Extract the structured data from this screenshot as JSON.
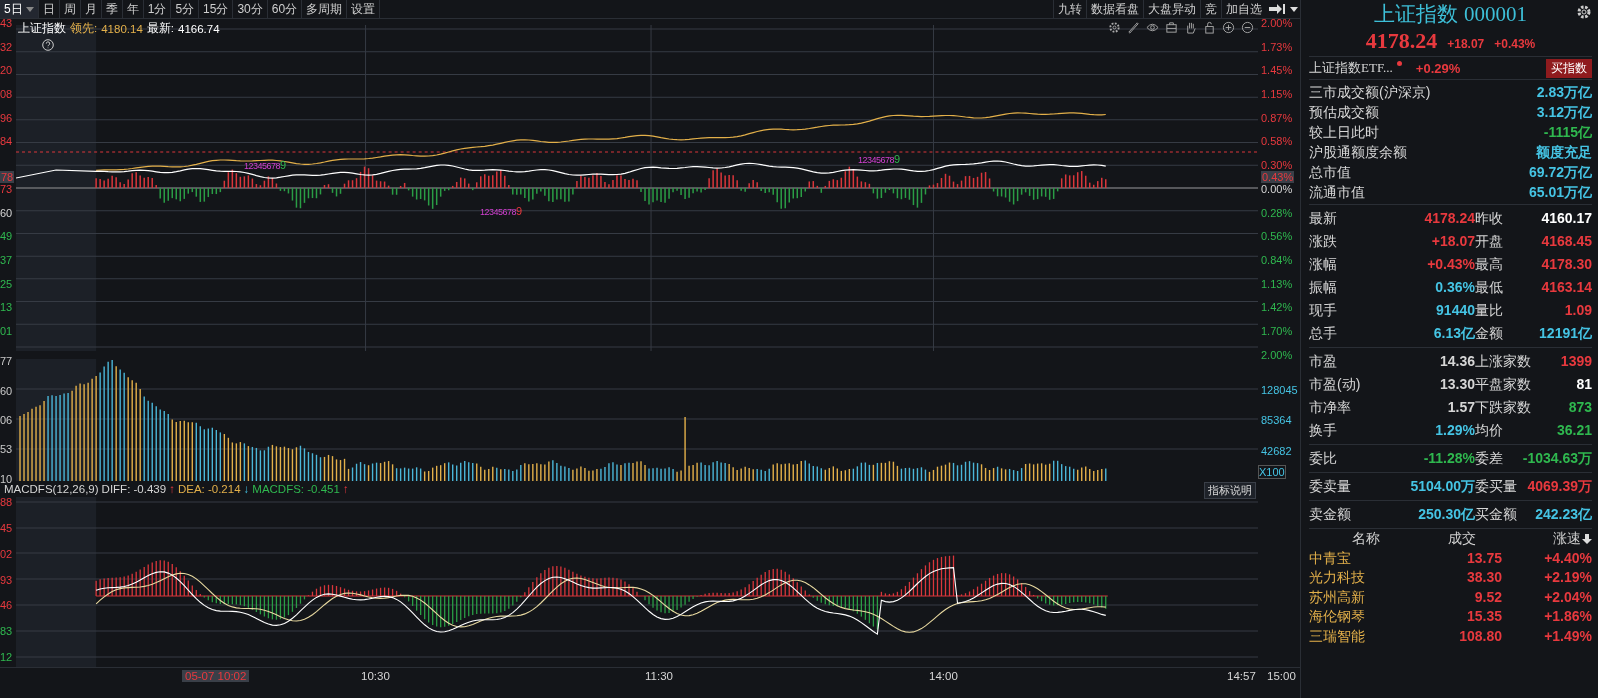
{
  "toolbar": {
    "periods": [
      {
        "label": "5日",
        "selected": true,
        "dropdown": true
      },
      {
        "label": "日",
        "selected": false,
        "dropdown": false
      },
      {
        "label": "周",
        "selected": false,
        "dropdown": false
      },
      {
        "label": "月",
        "selected": false,
        "dropdown": false
      },
      {
        "label": "季",
        "selected": false,
        "dropdown": false
      },
      {
        "label": "年",
        "selected": false,
        "dropdown": false
      },
      {
        "label": "1分",
        "selected": false,
        "dropdown": false
      },
      {
        "label": "5分",
        "selected": false,
        "dropdown": false
      },
      {
        "label": "15分",
        "selected": false,
        "dropdown": false
      },
      {
        "label": "30分",
        "selected": false,
        "dropdown": false
      },
      {
        "label": "60分",
        "selected": false,
        "dropdown": false
      },
      {
        "label": "多周期",
        "selected": false,
        "dropdown": false
      },
      {
        "label": "设置",
        "selected": false,
        "dropdown": false
      }
    ],
    "tools": [
      "九转",
      "数据看盘",
      "大盘异动",
      "竞",
      "加自选"
    ]
  },
  "chart_header": {
    "name": "上证指数",
    "lead_label": "领先:",
    "lead_value": "4180.14",
    "latest_label": "最新:",
    "latest_value": "4166.74"
  },
  "price_pane": {
    "left_ticks": [
      {
        "label": "43",
        "kind": "up"
      },
      {
        "label": "32",
        "kind": "up"
      },
      {
        "label": "20",
        "kind": "up"
      },
      {
        "label": "08",
        "kind": "up"
      },
      {
        "label": "96",
        "kind": "up"
      },
      {
        "label": "84",
        "kind": "up"
      },
      {
        "label": "73",
        "kind": "up"
      },
      {
        "label": "60",
        "kind": "flat"
      },
      {
        "label": "49",
        "kind": "down"
      },
      {
        "label": "37",
        "kind": "down"
      },
      {
        "label": "25",
        "kind": "down"
      },
      {
        "label": "13",
        "kind": "down"
      },
      {
        "label": "01",
        "kind": "down"
      }
    ],
    "left_current": "78",
    "right_ticks": [
      {
        "label": "2.00%",
        "kind": "up"
      },
      {
        "label": "1.73%",
        "kind": "up"
      },
      {
        "label": "1.45%",
        "kind": "up"
      },
      {
        "label": "1.15%",
        "kind": "up"
      },
      {
        "label": "0.87%",
        "kind": "up"
      },
      {
        "label": "0.58%",
        "kind": "up"
      },
      {
        "label": "0.30%",
        "kind": "up"
      },
      {
        "label": "0.00%",
        "kind": "flat"
      },
      {
        "label": "0.28%",
        "kind": "down"
      },
      {
        "label": "0.56%",
        "kind": "down"
      },
      {
        "label": "0.84%",
        "kind": "down"
      },
      {
        "label": "1.13%",
        "kind": "down"
      },
      {
        "label": "1.42%",
        "kind": "down"
      },
      {
        "label": "1.70%",
        "kind": "down"
      },
      {
        "label": "2.00%",
        "kind": "down"
      }
    ],
    "right_current": "0.43%",
    "markers": [
      {
        "digits": "12345678",
        "last": "9",
        "kind": "down"
      },
      {
        "digits": "12345678",
        "last": "9",
        "kind": "up"
      },
      {
        "digits": "12345678",
        "last": "9",
        "kind": "down"
      }
    ]
  },
  "volume_pane": {
    "left_ticks": [
      "77",
      "60",
      "06",
      "53",
      "10"
    ],
    "right_ticks": [
      "128045",
      "85364",
      "42682"
    ],
    "unit": "X100"
  },
  "macd_pane": {
    "legend": [
      {
        "text": "MACDFS(12,26,9)",
        "kind": "flat"
      },
      {
        "text": "DIFF: -0.439",
        "kind": "flat"
      },
      {
        "text": "↑",
        "kind": "up"
      },
      {
        "text": "DEA: -0.214",
        "kind": "yellow"
      },
      {
        "text": "↓",
        "kind": "info"
      },
      {
        "text": "MACDFS: -0.451",
        "kind": "down"
      },
      {
        "text": "↑",
        "kind": "up"
      }
    ],
    "help_button": "指标说明",
    "left_ticks": [
      {
        "label": "88",
        "kind": "up"
      },
      {
        "label": "45",
        "kind": "up"
      },
      {
        "label": "02",
        "kind": "up"
      },
      {
        "label": "93",
        "kind": "up"
      },
      {
        "label": "46",
        "kind": "up"
      },
      {
        "label": "83",
        "kind": "down"
      },
      {
        "label": "12",
        "kind": "down"
      }
    ]
  },
  "time_axis": [
    {
      "label": "05-07 10:02",
      "selected": true
    },
    {
      "label": "10:30",
      "selected": false
    },
    {
      "label": "11:30",
      "selected": false
    },
    {
      "label": "14:00",
      "selected": false
    },
    {
      "label": "14:57",
      "selected": false
    },
    {
      "label": "15:00",
      "selected": false
    }
  ],
  "quote_panel": {
    "name": "上证指数",
    "code": "000001",
    "price": "4178.24",
    "change": "+18.07",
    "change_pct": "+0.43%",
    "etf": {
      "name": "上证指数ETF...",
      "change_pct": "+0.29%",
      "button": "买指数"
    },
    "market_stats": [
      {
        "label": "三市成交额(沪深京)",
        "value": "2.83万亿",
        "kind": "info"
      },
      {
        "label": "预估成交额",
        "value": "3.12万亿",
        "kind": "info"
      },
      {
        "label": "较上日此时",
        "value": "-1115亿",
        "kind": "down"
      },
      {
        "label": "沪股通额度余额",
        "value": "额度充足",
        "kind": "info"
      },
      {
        "label": "总市值",
        "value": "69.72万亿",
        "kind": "info"
      },
      {
        "label": "流通市值",
        "value": "65.01万亿",
        "kind": "info"
      }
    ],
    "sections": [
      [
        [
          {
            "label": "最新",
            "value": "4178.24",
            "kind": "up"
          },
          {
            "label": "昨收",
            "value": "4160.17",
            "kind": "white"
          }
        ],
        [
          {
            "label": "涨跌",
            "value": "+18.07",
            "kind": "up"
          },
          {
            "label": "开盘",
            "value": "4168.45",
            "kind": "up"
          }
        ],
        [
          {
            "label": "涨幅",
            "value": "+0.43%",
            "kind": "up"
          },
          {
            "label": "最高",
            "value": "4178.30",
            "kind": "up"
          }
        ],
        [
          {
            "label": "振幅",
            "value": "0.36%",
            "kind": "info"
          },
          {
            "label": "最低",
            "value": "4163.14",
            "kind": "up"
          }
        ],
        [
          {
            "label": "现手",
            "value": "91440",
            "kind": "info"
          },
          {
            "label": "量比",
            "value": "1.09",
            "kind": "up"
          }
        ],
        [
          {
            "label": "总手",
            "value": "6.13亿",
            "kind": "info"
          },
          {
            "label": "金额",
            "value": "12191亿",
            "kind": "info"
          }
        ]
      ],
      [
        [
          {
            "label": "市盈",
            "value": "14.36",
            "kind": "flat"
          },
          {
            "label": "上涨家数",
            "value": "1399",
            "kind": "up"
          }
        ],
        [
          {
            "label": "市盈(动)",
            "value": "13.30",
            "kind": "flat"
          },
          {
            "label": "平盘家数",
            "value": "81",
            "kind": "white"
          }
        ],
        [
          {
            "label": "市净率",
            "value": "1.57",
            "kind": "flat"
          },
          {
            "label": "下跌家数",
            "value": "873",
            "kind": "down"
          }
        ],
        [
          {
            "label": "换手",
            "value": "1.29%",
            "kind": "info"
          },
          {
            "label": "均价",
            "value": "36.21",
            "kind": "down"
          }
        ]
      ],
      [
        [
          {
            "label": "委比",
            "value": "-11.28%",
            "kind": "down"
          },
          {
            "label": "委差",
            "value": "-1034.63万",
            "kind": "down"
          }
        ]
      ],
      [
        [
          {
            "label": "委卖量",
            "value": "5104.00万",
            "kind": "info"
          },
          {
            "label": "委买量",
            "value": "4069.39万",
            "kind": "up"
          }
        ]
      ],
      [
        [
          {
            "label": "卖金额",
            "value": "250.30亿",
            "kind": "info"
          },
          {
            "label": "买金额",
            "value": "242.23亿",
            "kind": "info"
          }
        ]
      ]
    ],
    "list": {
      "columns": [
        "名称",
        "成交",
        "涨速"
      ],
      "rows": [
        {
          "name": "中青宝",
          "price": "13.75",
          "change": "+4.40%",
          "kind": "up"
        },
        {
          "name": "光力科技",
          "price": "38.30",
          "change": "+2.19%",
          "kind": "up"
        },
        {
          "name": "苏州高新",
          "price": "9.52",
          "change": "+2.04%",
          "kind": "up"
        },
        {
          "name": "海伦钢琴",
          "price": "15.35",
          "change": "+1.86%",
          "kind": "up"
        },
        {
          "name": "三瑞智能",
          "price": "108.80",
          "change": "+1.49%",
          "kind": "up"
        }
      ]
    }
  }
}
